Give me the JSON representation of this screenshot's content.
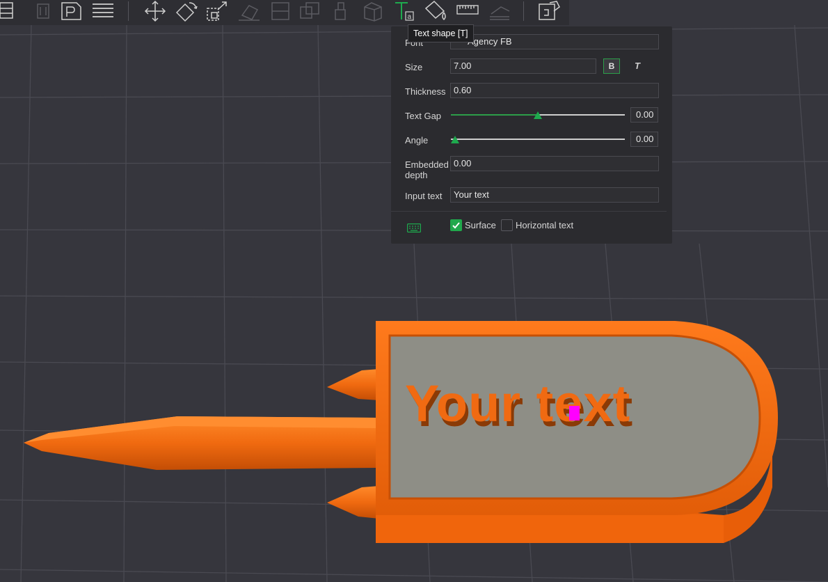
{
  "toolbar": {
    "icons": [
      "arrange-icon",
      "orient-icon",
      "plate-icon",
      "layers-icon",
      "move-icon",
      "rotate-icon",
      "scale-icon",
      "lay-on-face-icon",
      "cut-icon",
      "mesh-boolean-icon",
      "support-paint-icon",
      "seam-paint-icon",
      "text-shape-icon",
      "color-paint-icon",
      "measure-icon",
      "assembly-icon",
      "variable-height-icon"
    ]
  },
  "tooltip": {
    "text": "Text shape [T]"
  },
  "panel": {
    "font": {
      "label": "Font",
      "value": "Agency FB"
    },
    "size": {
      "label": "Size",
      "value": "7.00",
      "bold_label": "B",
      "italic_label": "T"
    },
    "thickness": {
      "label": "Thickness",
      "value": "0.60"
    },
    "text_gap": {
      "label": "Text Gap",
      "value": "0.00",
      "slider_fraction": 0.5
    },
    "angle": {
      "label": "Angle",
      "value": "0.00",
      "slider_fraction": 0.0
    },
    "embedded_depth": {
      "label_line1": "Embedded",
      "label_line2": "depth",
      "value": "0.00"
    },
    "input_text": {
      "label": "Input text",
      "value": "Your text"
    },
    "surface": {
      "label": "Surface",
      "checked": true
    },
    "horizontal_text": {
      "label": "Horizontal text",
      "checked": false
    }
  },
  "scene": {
    "embossed_text": "Your text"
  },
  "colors": {
    "accent": "#1eaa4e",
    "model": "#f26b10",
    "plate": "#8e8e86",
    "cursor": "#ff00ff",
    "background": "#36363d"
  }
}
